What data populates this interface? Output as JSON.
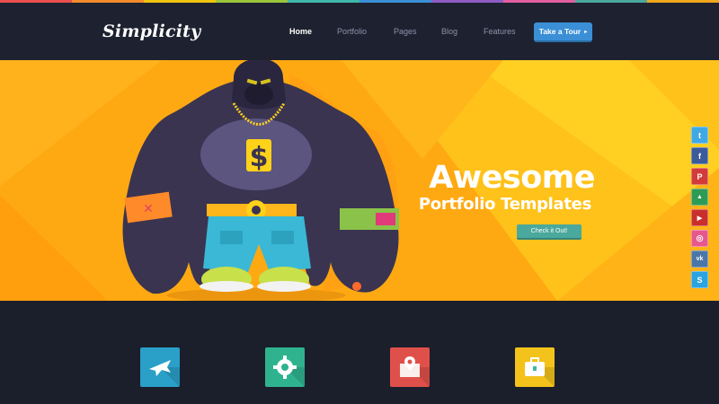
{
  "colors": {
    "strip": [
      "#ea4f4f",
      "#f38a2b",
      "#f1c40f",
      "#9bc63c",
      "#3fb8a8",
      "#3b8fd6",
      "#8e5cc2",
      "#e25f9e",
      "#4aa89c",
      "#f2a81d"
    ],
    "nav_bg": "#1e2230",
    "hero_bg": "#ffa912",
    "accent_blue": "#3b8fd6",
    "cta_teal": "#4aa89c"
  },
  "header": {
    "logo": "Simplicity",
    "nav": [
      {
        "label": "Home",
        "active": true
      },
      {
        "label": "Portfolio",
        "active": false
      },
      {
        "label": "Pages",
        "active": false
      },
      {
        "label": "Blog",
        "active": false
      },
      {
        "label": "Features",
        "active": false
      }
    ],
    "tour_button": "Take a Tour",
    "tour_arrow": "▸"
  },
  "hero": {
    "title": "Awesome",
    "subtitle": "Portfolio Templates",
    "cta": "Check it Out!",
    "mascot": "gorilla-mascot",
    "dollar_sign": "$"
  },
  "social": [
    {
      "name": "twitter-icon",
      "glyph": "t",
      "color": "#3fa9e6"
    },
    {
      "name": "facebook-icon",
      "glyph": "f",
      "color": "#3b5b9a"
    },
    {
      "name": "pinterest-icon",
      "glyph": "P",
      "color": "#d33b3b"
    },
    {
      "name": "google-drive-icon",
      "glyph": "▲",
      "color": "#2e9b55"
    },
    {
      "name": "youtube-icon",
      "glyph": "▶",
      "color": "#c9302c"
    },
    {
      "name": "dribbble-icon",
      "glyph": "◎",
      "color": "#e6578c"
    },
    {
      "name": "vk-icon",
      "glyph": "vk",
      "color": "#4a76a8"
    },
    {
      "name": "skype-icon",
      "glyph": "S",
      "color": "#2aa3e0"
    }
  ],
  "features": [
    {
      "name": "airplane-icon",
      "color": "#2aa0c8"
    },
    {
      "name": "gear-icon",
      "color": "#2fb38f"
    },
    {
      "name": "map-pin-icon",
      "color": "#e0504a"
    },
    {
      "name": "briefcase-icon",
      "color": "#f3c21b"
    }
  ]
}
